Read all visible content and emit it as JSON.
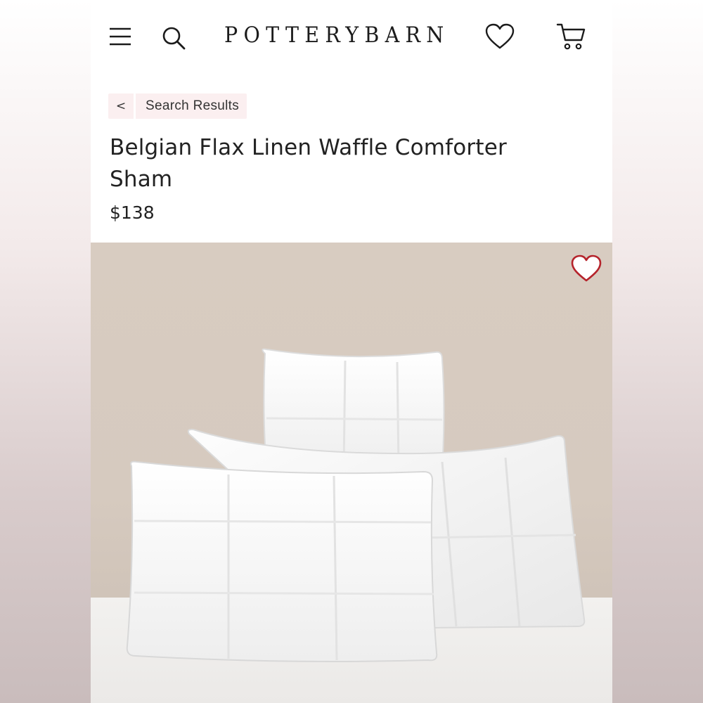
{
  "header": {
    "logo_text": "POTTERYBARN",
    "icons": {
      "menu": "hamburger-menu-icon",
      "search": "search-icon",
      "wishlist": "heart-outline-icon",
      "cart": "shopping-cart-icon"
    }
  },
  "breadcrumb": {
    "back_glyph": "<",
    "label": "Search Results"
  },
  "product": {
    "title": "Belgian Flax Linen Waffle Comforter Sham",
    "price": "$138",
    "image_alt_icon": "heart-outline-icon"
  },
  "colors": {
    "accent_red": "#b5232b",
    "breadcrumb_bg": "#fbeff0",
    "text_dark": "#222222",
    "backdrop_wall": "#d8ccc1"
  }
}
